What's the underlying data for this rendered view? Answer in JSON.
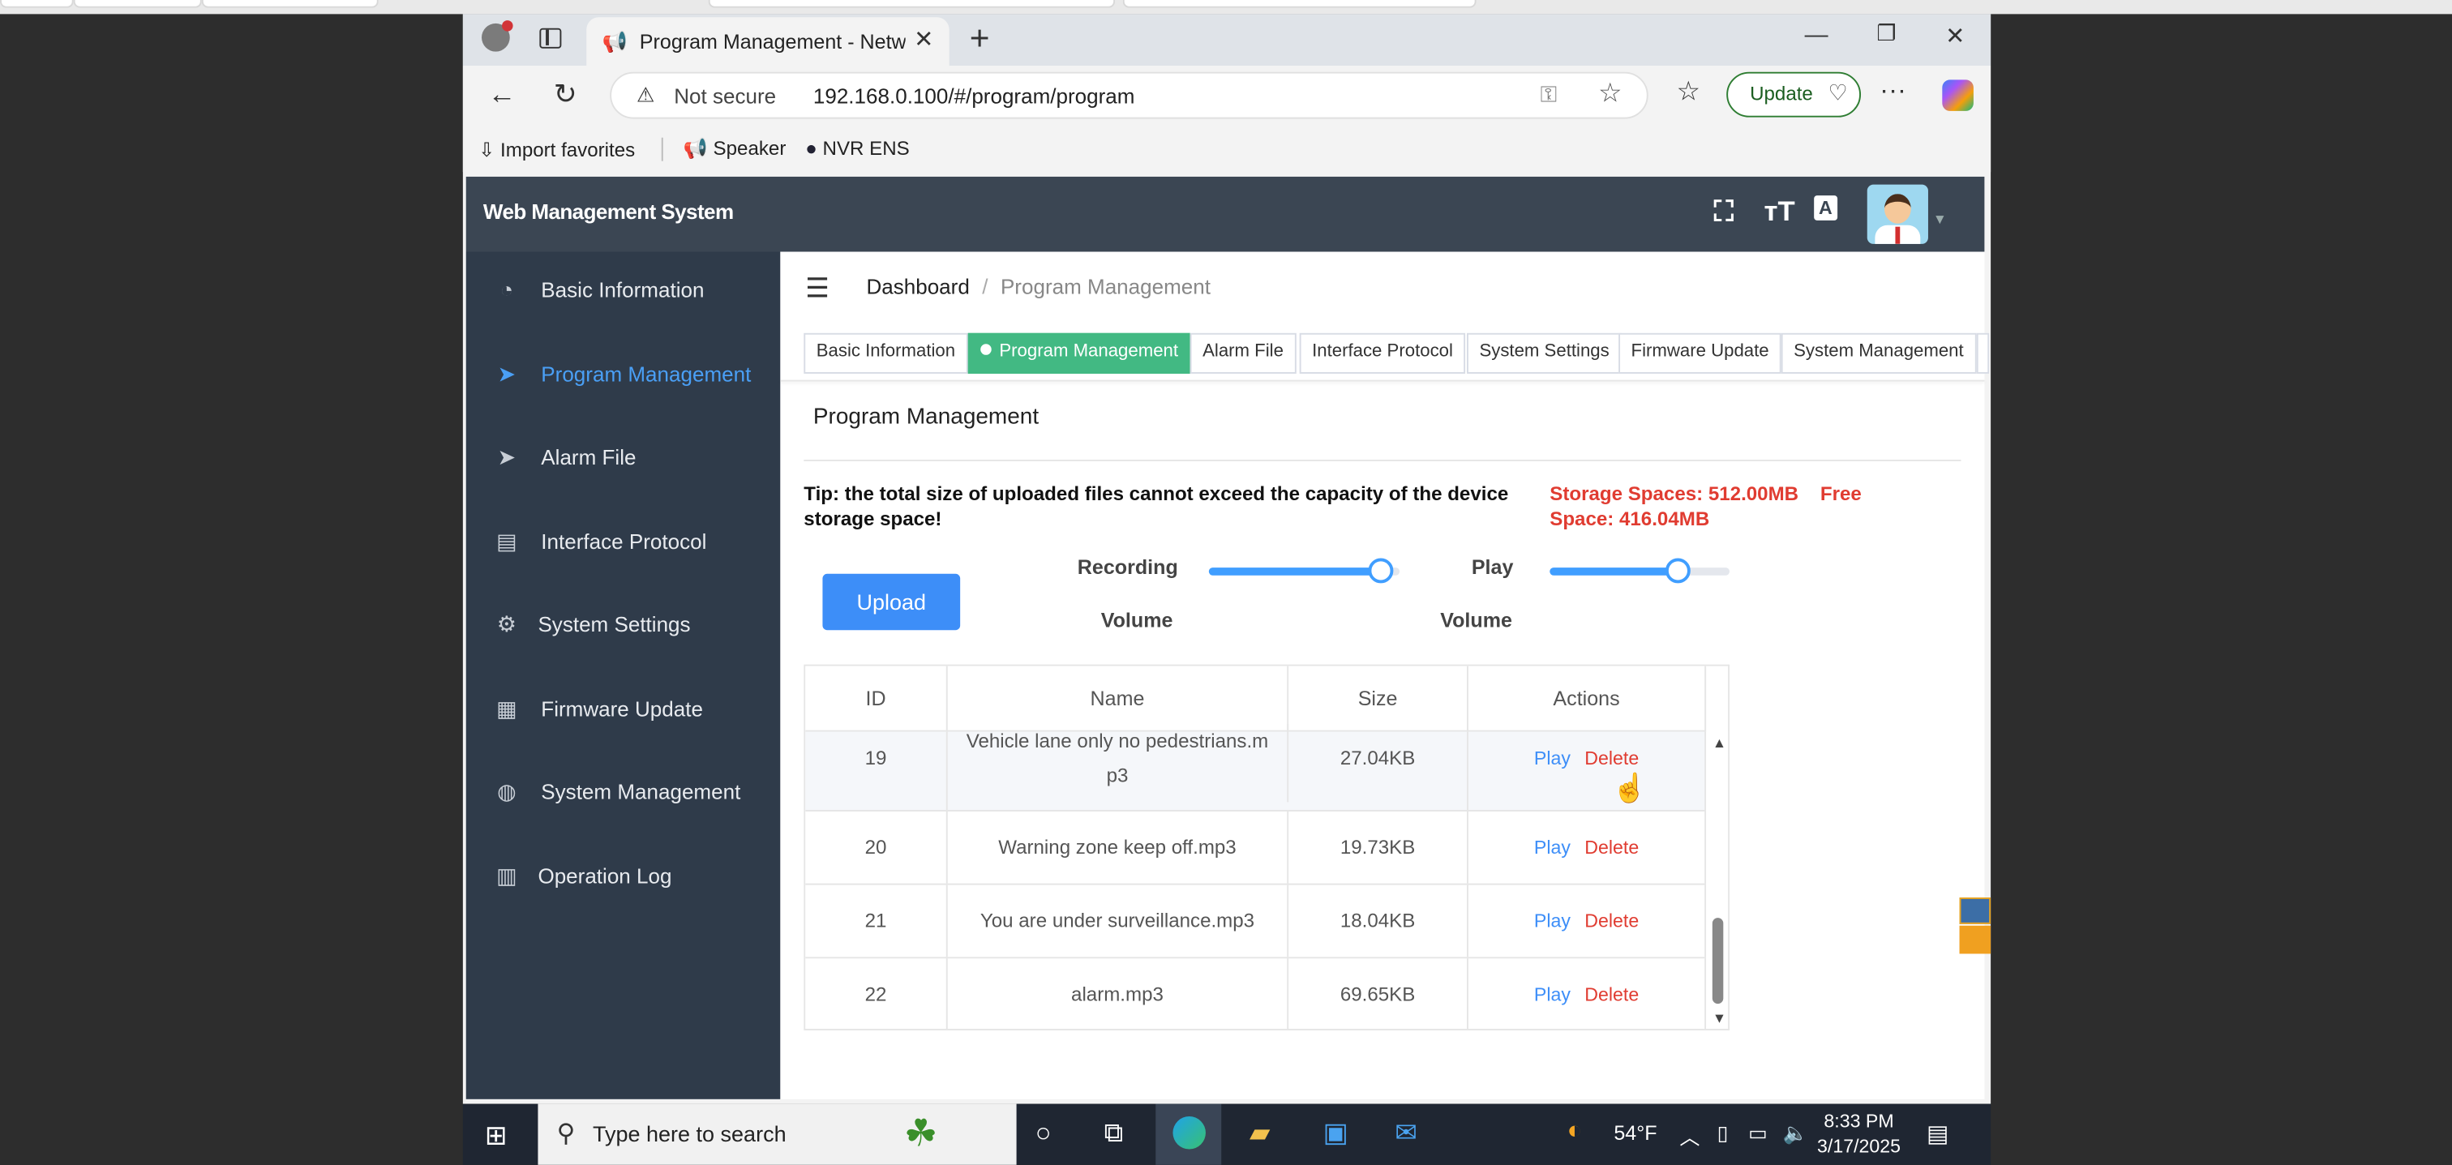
{
  "browser": {
    "tab_title": "Program Management - Network",
    "url_security": "Not secure",
    "url": "192.168.0.100/#/program/program",
    "update_label": "Update",
    "favorites": [
      "Import favorites",
      "Speaker",
      "NVR ENS"
    ]
  },
  "app": {
    "brand": "Web Management System",
    "sidebar": [
      {
        "label": "Basic Information",
        "icon": "dashboard-icon",
        "active": false
      },
      {
        "label": "Program Management",
        "icon": "send-icon",
        "active": true
      },
      {
        "label": "Alarm File",
        "icon": "send-icon",
        "active": false
      },
      {
        "label": "Interface Protocol",
        "icon": "document-icon",
        "active": false
      },
      {
        "label": "System Settings",
        "icon": "gear-icon",
        "active": false
      },
      {
        "label": "Firmware Update",
        "icon": "grid-icon",
        "active": false
      },
      {
        "label": "System Management",
        "icon": "globe-icon",
        "active": false
      },
      {
        "label": "Operation Log",
        "icon": "log-icon",
        "active": false
      }
    ],
    "breadcrumb": {
      "root": "Dashboard",
      "current": "Program Management"
    },
    "tags": [
      "Basic Information",
      "Program Management",
      "Alarm File",
      "Interface Protocol",
      "System Settings",
      "Firmware Update",
      "System Management"
    ],
    "page_title": "Program Management",
    "tip": "Tip: the total size of uploaded files cannot exceed the capacity of the device storage space!",
    "storage": "Storage Spaces: 512.00MB",
    "free": "Free Space: 416.04MB",
    "upload_label": "Upload",
    "recording_label_1": "Recording",
    "recording_label_2": "Volume",
    "play_label_1": "Play",
    "play_label_2": "Volume",
    "recording_volume_fraction": 0.9,
    "play_volume_fraction": 0.71,
    "table": {
      "headers": [
        "ID",
        "Name",
        "Size",
        "Actions"
      ],
      "rows": [
        {
          "id": "19",
          "name": "Vehicle lane only no pedestrians.mp3",
          "name_l1": "Vehicle lane only no pedestrians.m",
          "name_l2": "p3",
          "size": "27.04KB"
        },
        {
          "id": "20",
          "name": "Warning zone keep off.mp3",
          "size": "19.73KB"
        },
        {
          "id": "21",
          "name": "You are under surveillance.mp3",
          "size": "18.04KB"
        },
        {
          "id": "22",
          "name": "alarm.mp3",
          "size": "69.65KB"
        }
      ],
      "play_label": "Play",
      "delete_label": "Delete"
    }
  },
  "taskbar": {
    "search_placeholder": "Type here to search",
    "weather": "54°F",
    "time": "8:33 PM",
    "date": "3/17/2025"
  }
}
